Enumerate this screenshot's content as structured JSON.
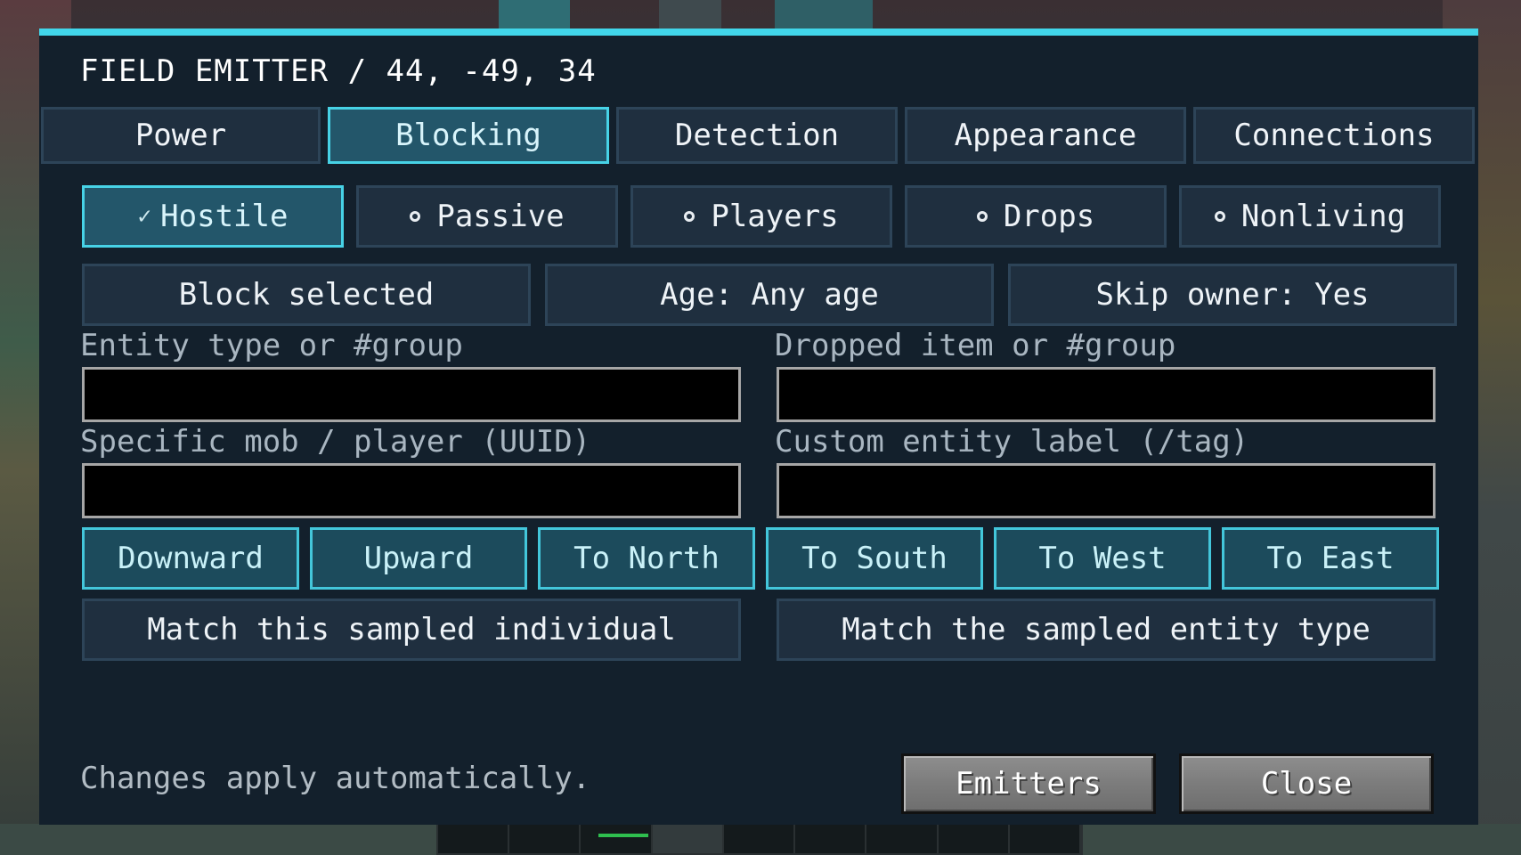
{
  "window": {
    "title": "FIELD EMITTER / 44, -49, 34"
  },
  "tabs": [
    {
      "label": "Power"
    },
    {
      "label": "Blocking"
    },
    {
      "label": "Detection"
    },
    {
      "label": "Appearance"
    },
    {
      "label": "Connections"
    }
  ],
  "active_tab": "Blocking",
  "filters": [
    {
      "label": "Hostile",
      "checked": true,
      "mark": "✓"
    },
    {
      "label": "Passive",
      "checked": false
    },
    {
      "label": "Players",
      "checked": false
    },
    {
      "label": "Drops",
      "checked": false
    },
    {
      "label": "Nonliving",
      "checked": false
    }
  ],
  "options": {
    "block_selected": "Block selected",
    "age": "Age: Any age",
    "skip_owner": "Skip owner: Yes"
  },
  "fields": {
    "entity_type": {
      "label": "Entity type or #group",
      "value": ""
    },
    "dropped_item": {
      "label": "Dropped item or #group",
      "value": ""
    },
    "specific_mob": {
      "label": "Specific mob / player (UUID)",
      "value": ""
    },
    "custom_label": {
      "label": "Custom entity label (/tag)",
      "value": ""
    }
  },
  "directions": [
    {
      "label": "Downward"
    },
    {
      "label": "Upward"
    },
    {
      "label": "To North"
    },
    {
      "label": "To South"
    },
    {
      "label": "To West"
    },
    {
      "label": "To East"
    }
  ],
  "match": {
    "individual": "Match this sampled individual",
    "entity_type": "Match the sampled entity type"
  },
  "footer": {
    "status": "Changes apply automatically.",
    "emitters_label": "Emitters",
    "close_label": "Close"
  },
  "colors": {
    "accent": "#41d6ea",
    "panel": "#13202c",
    "button": "#1f2f3f",
    "active_button": "#23566a"
  }
}
